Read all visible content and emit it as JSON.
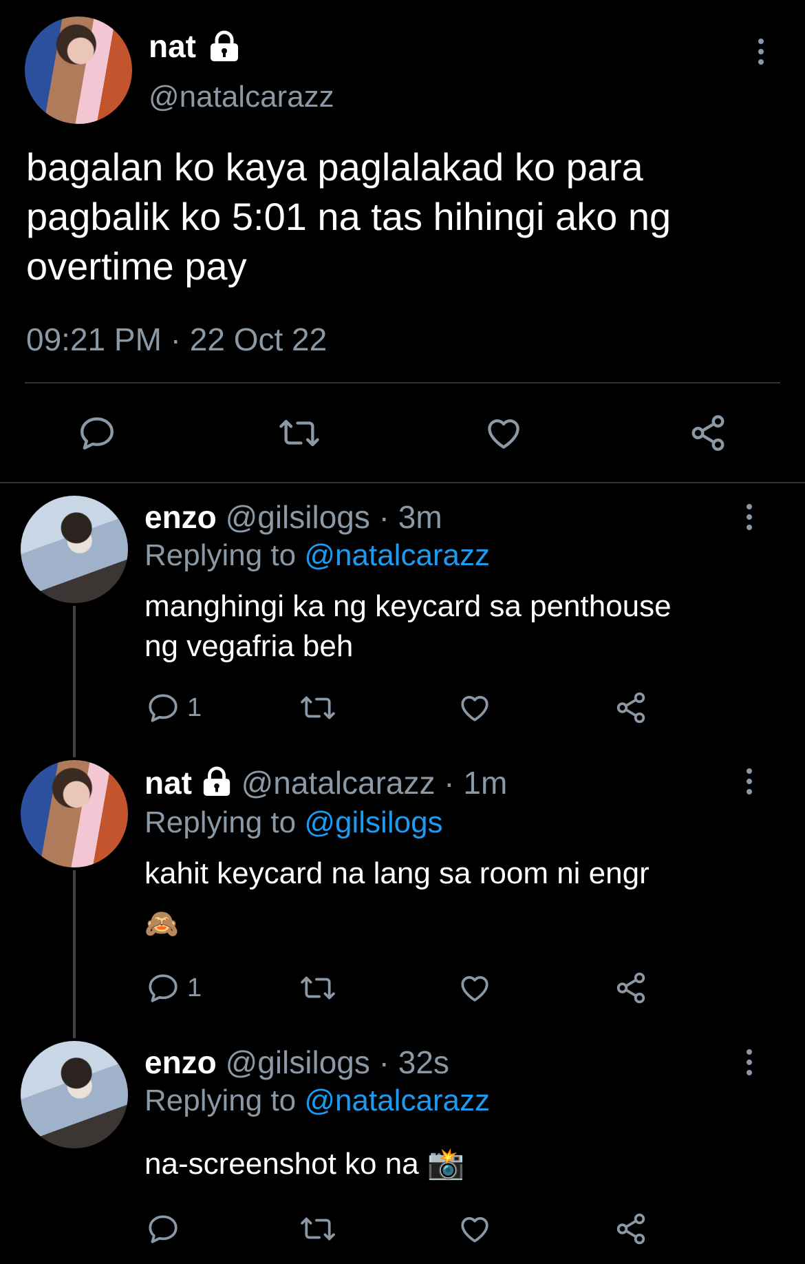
{
  "main_tweet": {
    "display_name": "nat",
    "handle": "@natalcarazz",
    "text_lines": [
      "bagalan ko kaya paglalakad ko para",
      "pagbalik ko 5:01 na tas hihingi ako ng",
      "overtime pay"
    ],
    "timestamp": "09:21 PM · 22 Oct 22"
  },
  "replies": [
    {
      "display_name": "enzo",
      "meta": "@gilsilogs · 3m",
      "replying_prefix": "Replying to ",
      "replying_handle": "@natalcarazz",
      "text_lines": [
        "manghingi ka ng keycard sa penthouse",
        "ng vegafria beh"
      ],
      "reply_count": "1"
    },
    {
      "display_name": "nat",
      "meta": "@natalcarazz · 1m",
      "replying_prefix": "Replying to ",
      "replying_handle": "@gilsilogs",
      "text_lines": [
        "kahit keycard na lang sa room ni engr",
        "🙈"
      ],
      "reply_count": "1"
    },
    {
      "display_name": "enzo",
      "meta": "@gilsilogs · 32s",
      "replying_prefix": "Replying to ",
      "replying_handle": "@natalcarazz",
      "text_lines": [
        "na-screenshot ko na 📸"
      ],
      "reply_count": ""
    }
  ],
  "icons": {
    "lock": "lock-icon",
    "more": "more-vertical-icon",
    "reply": "reply-icon",
    "retweet": "retweet-icon",
    "like": "heart-icon",
    "share": "share-icon"
  },
  "colors": {
    "background": "#000000",
    "text": "#ffffff",
    "muted": "#8b98a5",
    "link": "#1d9bf0"
  }
}
